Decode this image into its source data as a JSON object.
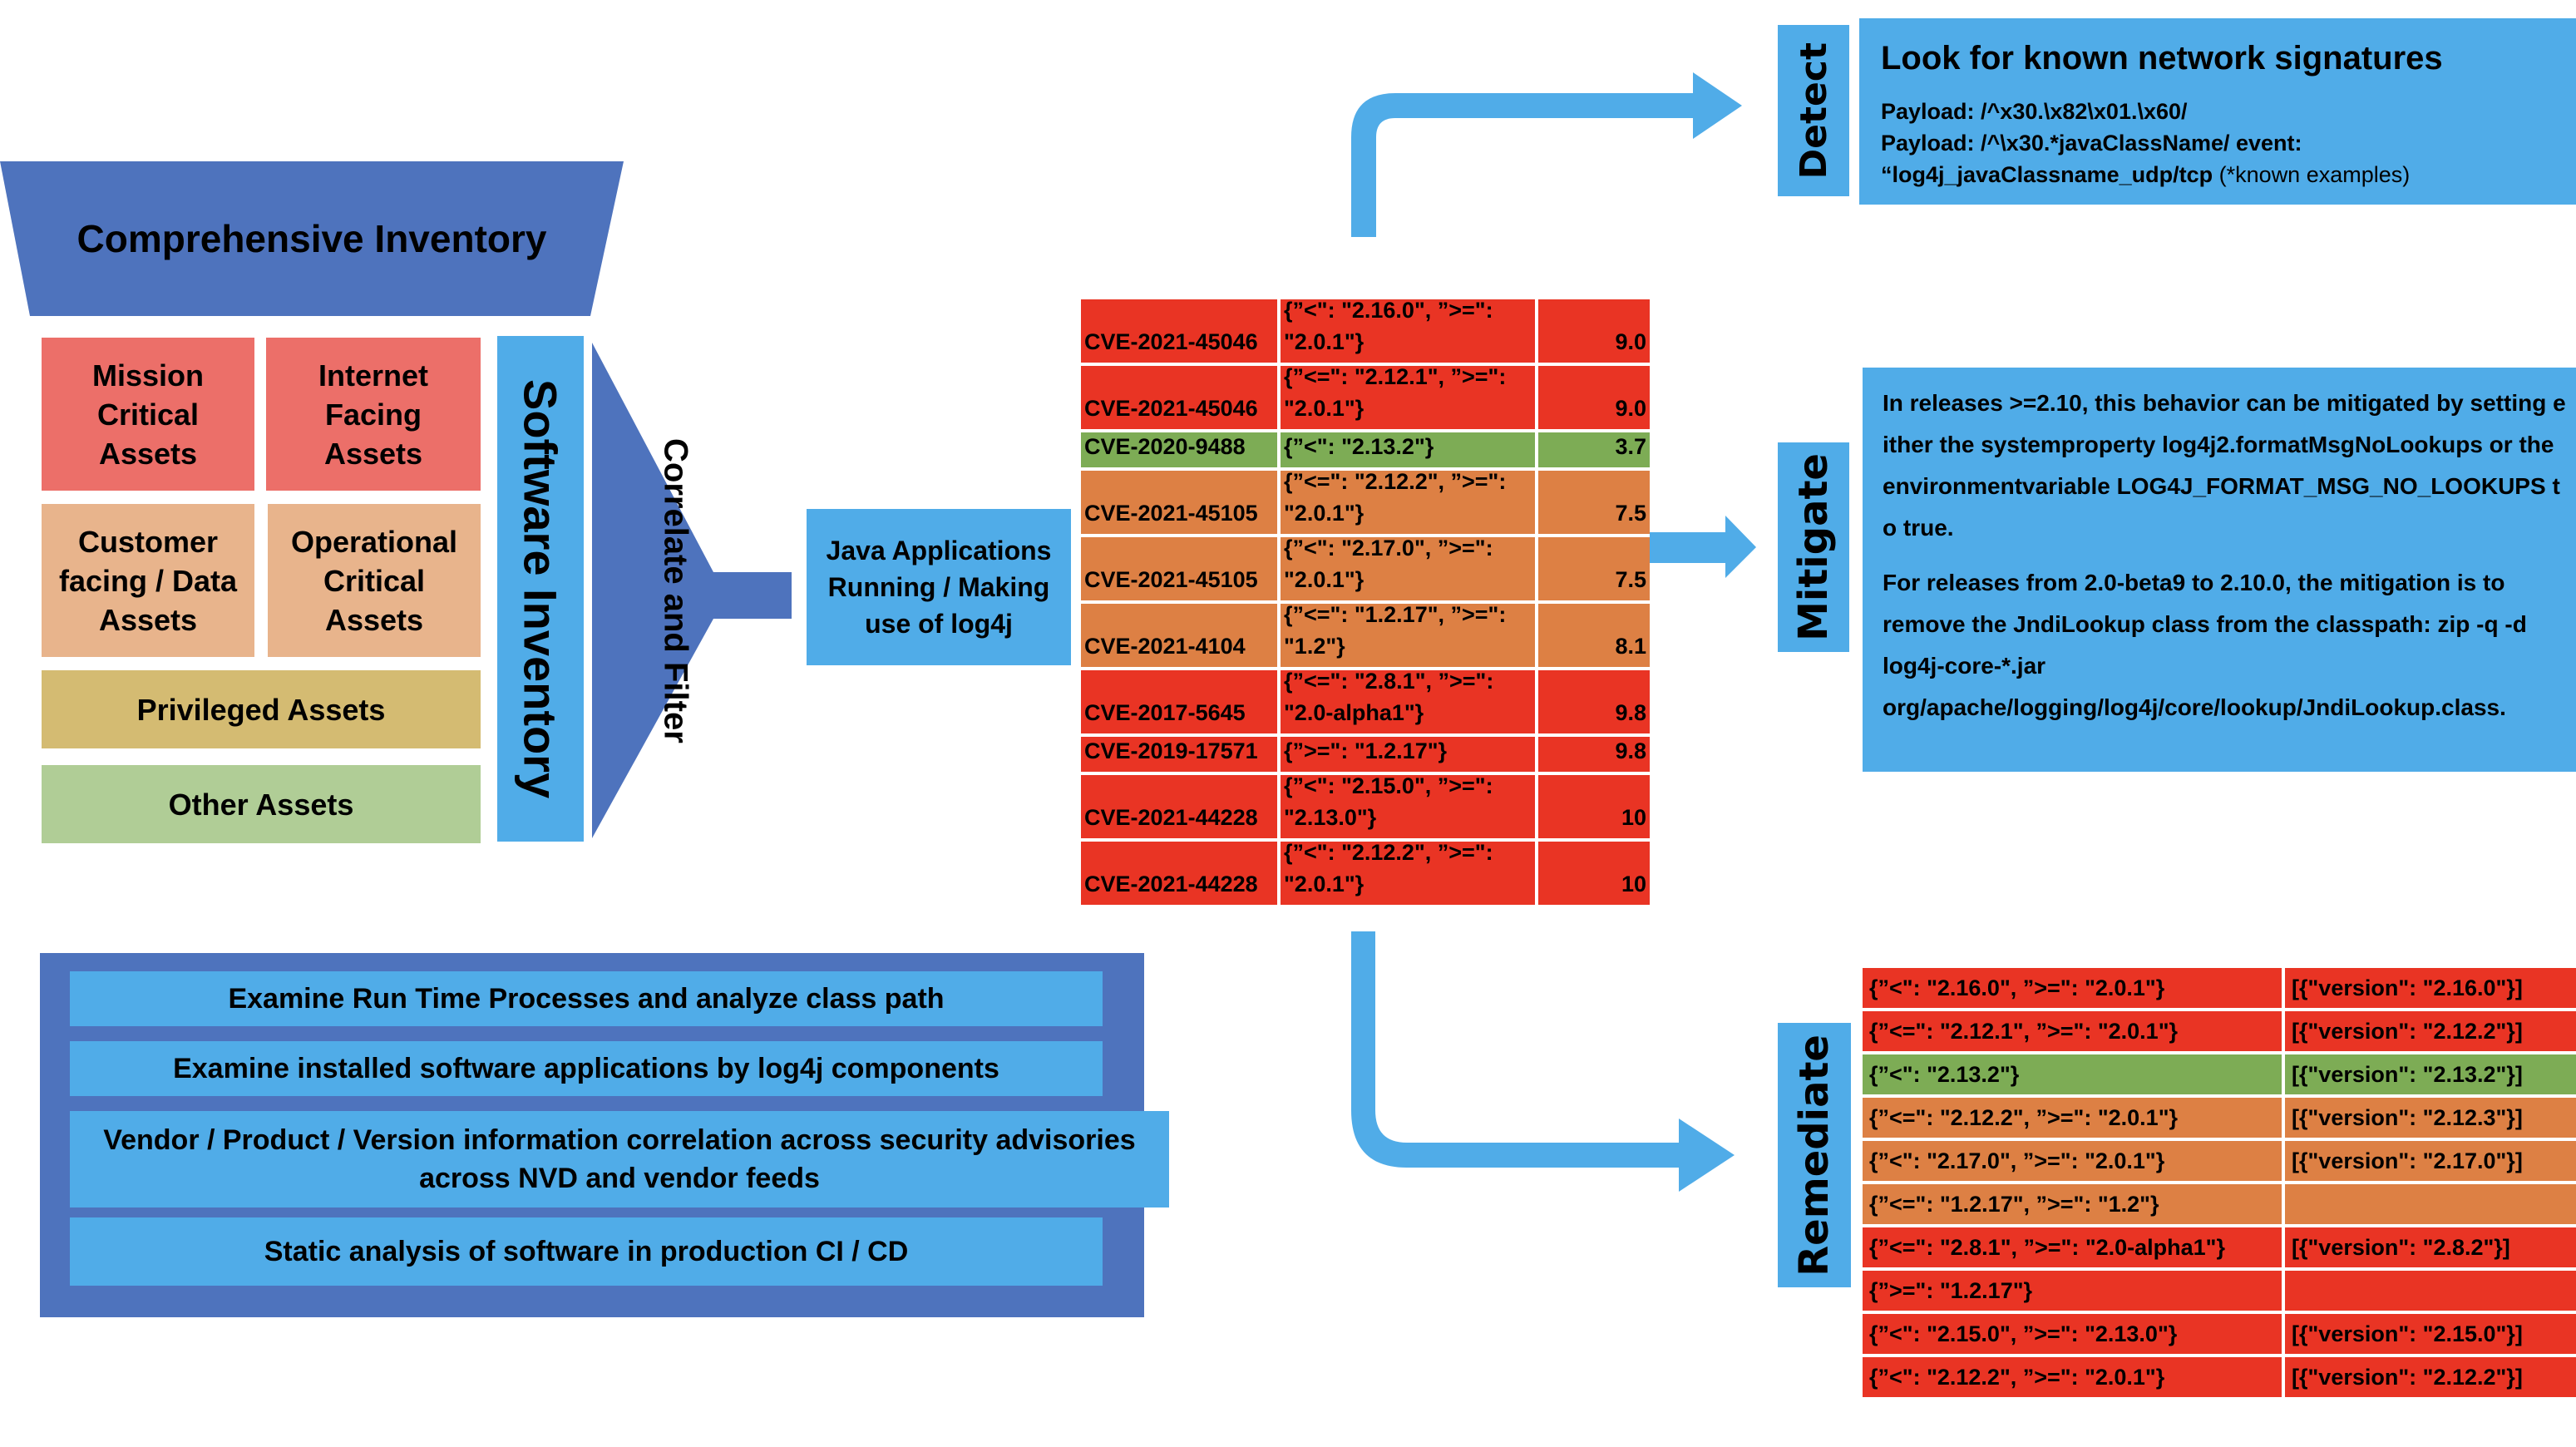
{
  "inventory": {
    "title": "Comprehensive Inventory",
    "assets": [
      {
        "label": "Mission Critical Assets",
        "tier": "critical"
      },
      {
        "label": "Internet Facing Assets",
        "tier": "critical"
      },
      {
        "label": "Customer facing / Data Assets",
        "tier": "high"
      },
      {
        "label": "Operational Critical Assets",
        "tier": "high"
      },
      {
        "label": "Privileged Assets",
        "tier": "medium"
      },
      {
        "label": "Other Assets",
        "tier": "low"
      }
    ],
    "software_inventory_label": "Software Inventory",
    "correlate_label": "Correlate and Filter"
  },
  "java_apps_label": "Java Applications Running / Making use of log4j",
  "cve_table": [
    {
      "cve": "CVE-2021-45046",
      "range": "{”<\": \"2.16.0\", ”>=\":\n\"2.0.1\"}",
      "score": "9.0",
      "severity": "red"
    },
    {
      "cve": "CVE-2021-45046",
      "range": "{”<=\": \"2.12.1\", ”>=\":\n\"2.0.1\"}",
      "score": "9.0",
      "severity": "red"
    },
    {
      "cve": "CVE-2020-9488",
      "range": "{”<\": \"2.13.2\"}",
      "score": "3.7",
      "severity": "green"
    },
    {
      "cve": "CVE-2021-45105",
      "range": "{”<=\": \"2.12.2\", ”>=\":\n\"2.0.1\"}",
      "score": "7.5",
      "severity": "orange"
    },
    {
      "cve": "CVE-2021-45105",
      "range": "{”<\": \"2.17.0\", ”>=\":\n\"2.0.1\"}",
      "score": "7.5",
      "severity": "orange"
    },
    {
      "cve": "CVE-2021-4104",
      "range": "{”<=\": \"1.2.17\", ”>=\":\n\"1.2\"}",
      "score": "8.1",
      "severity": "orange"
    },
    {
      "cve": "CVE-2017-5645",
      "range": "{”<=\": \"2.8.1\",  ”>=\":\n\"2.0-alpha1\"}",
      "score": "9.8",
      "severity": "red"
    },
    {
      "cve": "CVE-2019-17571",
      "range": "{”>=\": \"1.2.17\"}",
      "score": "9.8",
      "severity": "red"
    },
    {
      "cve": "CVE-2021-44228",
      "range": "{”<\": \"2.15.0\", ”>=\":\n\"2.13.0\"}",
      "score": "10",
      "severity": "red"
    },
    {
      "cve": "CVE-2021-44228",
      "range": "{”<\": \"2.12.2\", ”>=\":\n\"2.0.1\"}",
      "score": "10",
      "severity": "red"
    }
  ],
  "detect": {
    "tab_label": "Detect",
    "heading": "Look for known network signatures",
    "lines": [
      "Payload: /^x30.\\x82\\x01.\\x60/",
      "Payload: /^\\x30.*javaClassName/ event:",
      "“log4j_javaClassname_udp/tcp"
    ],
    "note": " (*known examples)"
  },
  "mitigate": {
    "tab_label": "Mitigate",
    "paragraphs": [
      "In releases >=2.10, this behavior can be mitigated by setting either the systemproperty log4j2.formatMsgNoLookups or the environmentvariable LOG4J_FORMAT_MSG_NO_LOOKUPS to true.",
      "For releases from 2.0-beta9 to 2.10.0, the mitigation is to remove the JndiLookup class from the classpath: zip -q -d log4j-core-*.jar org/apache/logging/log4j/core/lookup/JndiLookup.class."
    ]
  },
  "remediate": {
    "tab_label": "Remediate",
    "rows": [
      {
        "range": "{”<\": \"2.16.0\", ”>=\": \"2.0.1\"}",
        "fix": "[{\"version\": \"2.16.0\"}]",
        "severity": "red"
      },
      {
        "range": "{”<=\": \"2.12.1\", ”>=\": \"2.0.1\"}",
        "fix": "[{\"version\": \"2.12.2\"}]",
        "severity": "red"
      },
      {
        "range": "{”<\": \"2.13.2\"}",
        "fix": "[{\"version\": \"2.13.2\"}]",
        "severity": "green"
      },
      {
        "range": "{”<=\": \"2.12.2\", ”>=\": \"2.0.1\"}",
        "fix": "[{\"version\": \"2.12.3\"}]",
        "severity": "orange"
      },
      {
        "range": "{”<\": \"2.17.0\", ”>=\": \"2.0.1\"}",
        "fix": "[{\"version\": \"2.17.0\"}]",
        "severity": "orange"
      },
      {
        "range": "{”<=\": \"1.2.17\", ”>=\": \"1.2\"}",
        "fix": "",
        "severity": "orange"
      },
      {
        "range": "{”<=\": \"2.8.1\",  ”>=\": \"2.0-alpha1\"}",
        "fix": "[{\"version\": \"2.8.2\"}]",
        "severity": "red"
      },
      {
        "range": "{”>=\": \"1.2.17\"}",
        "fix": "",
        "severity": "red"
      },
      {
        "range": "{”<\": \"2.15.0\", ”>=\": \"2.13.0\"}",
        "fix": "[{\"version\": \"2.15.0\"}]",
        "severity": "red"
      },
      {
        "range": "{”<\": \"2.12.2\", ”>=\": \"2.0.1\"}",
        "fix": "[{\"version\": \"2.12.2\"}]",
        "severity": "red"
      }
    ]
  },
  "steps": [
    "Examine Run Time Processes and analyze class path",
    "Examine installed software applications by log4j components",
    "Vendor / Product / Version information correlation across security advisories across NVD and vendor feeds",
    "Static analysis of software in production CI / CD"
  ],
  "colors": {
    "severity_red": "#e93424",
    "severity_orange": "#dd8044",
    "severity_green": "#7dac55",
    "box_blue": "#50ace8",
    "funnel_blue": "#4e73bd"
  }
}
